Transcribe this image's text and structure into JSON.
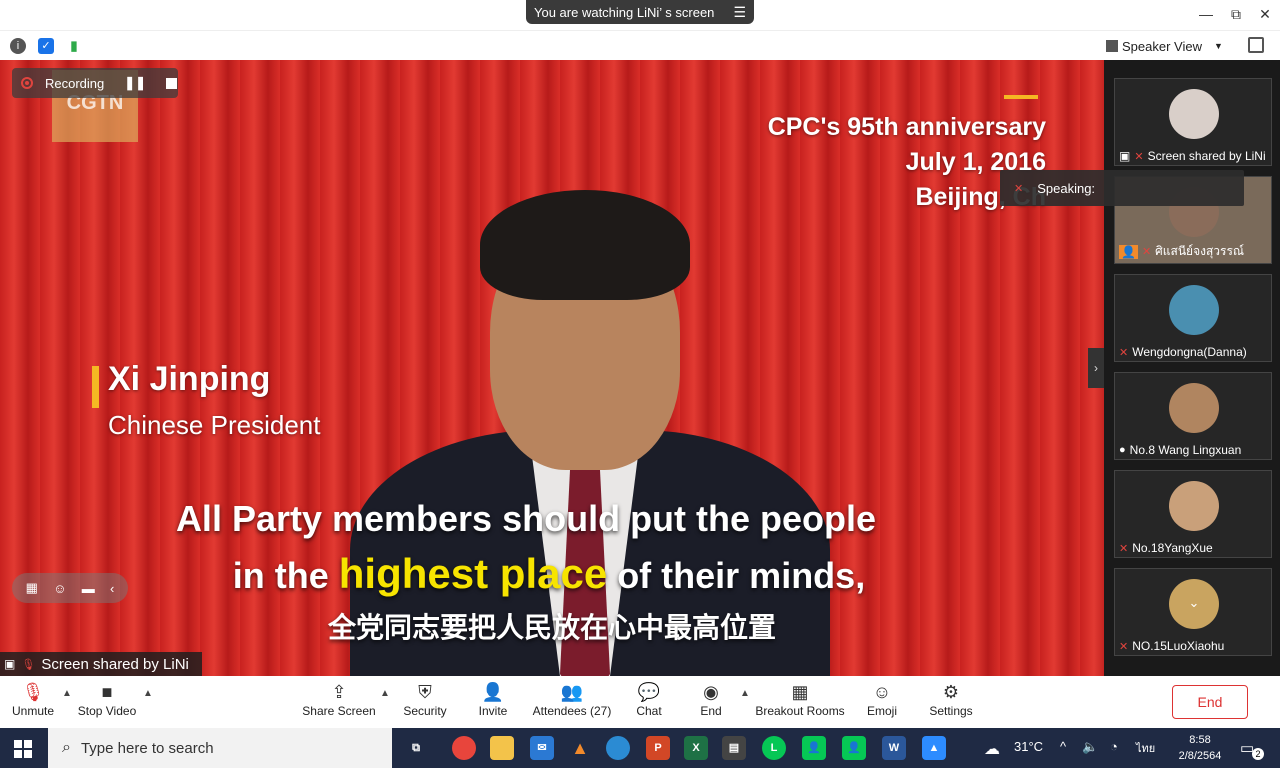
{
  "topbar": {
    "watching_text": "You are watching LiNi’ s screen",
    "minimize": "—",
    "restore": "⧉",
    "close": "✕"
  },
  "viewbar": {
    "view_label": "Speaker View"
  },
  "video": {
    "channel_logo": "CGTN",
    "event_line1": "CPC's 95th anniversary",
    "event_line2": "July 1, 2016",
    "event_line3": "Beijing, Ch",
    "speaker_name": "Xi Jinping",
    "speaker_title": "Chinese President",
    "subtitle_line1": "All Party members should put the people",
    "subtitle_line2_pre": "in the ",
    "subtitle_line2_highlight": "highest place",
    "subtitle_line2_post": " of their minds,",
    "subtitle_cn": "全党同志要把人民放在心中最高位置"
  },
  "recording": {
    "label": "Recording"
  },
  "share_label": "Screen shared by LiNi",
  "speaking": {
    "label": "Speaking:"
  },
  "participants": [
    {
      "name": "Screen shared by LiNi",
      "avatar_color": "#d9cfc9"
    },
    {
      "name": "ศิแสนีย์จงสุวรรณ์",
      "avatar_color": "#8a6c5a"
    },
    {
      "name": "Wengdongna(Danna)",
      "avatar_color": "#4a8fb0"
    },
    {
      "name": "No.8 Wang Lingxuan",
      "avatar_color": "#b08560"
    },
    {
      "name": "No.18YangXue",
      "avatar_color": "#c9a07a"
    },
    {
      "name": "NO.15LuoXiaohu",
      "avatar_color": "#c9a460"
    }
  ],
  "controls": {
    "unmute": "Unmute",
    "stop_video": "Stop Video",
    "share_screen": "Share Screen",
    "security": "Security",
    "invite": "Invite",
    "attendees": "Attendees (27)",
    "chat": "Chat",
    "end_small": "End",
    "breakout": "Breakout Rooms",
    "emoji": "Emoji",
    "settings": "Settings",
    "end_button": "End"
  },
  "taskbar": {
    "search_placeholder": "Type here to search",
    "weather": "31°C",
    "language": "ไทย",
    "time": "8:58",
    "date": "2/8/2564",
    "notifications": "2"
  }
}
